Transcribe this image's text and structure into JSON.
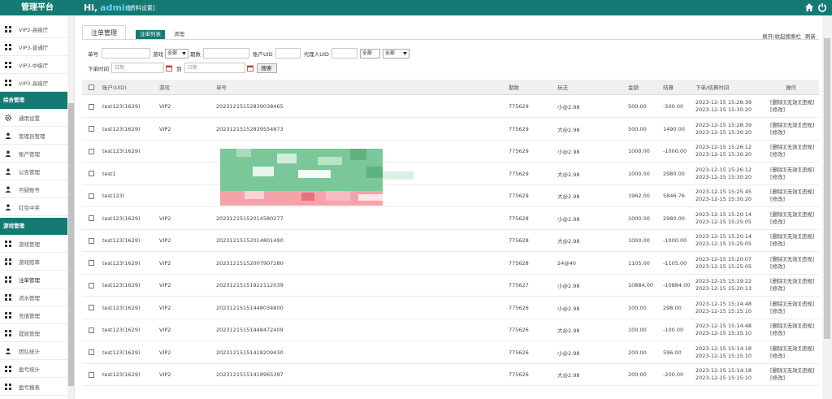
{
  "app": {
    "title": "管理平台",
    "greeting": "Hi,",
    "username": "admin",
    "profile_link": "[资料设置]",
    "colors": {
      "header": "#157a74",
      "username": "#5fd0ff",
      "mosaic_green": "#7cc79a",
      "mosaic_red": "#f5a3a9"
    },
    "icons": [
      "home-icon",
      "power-icon"
    ]
  },
  "sidebar": {
    "top_items": [
      {
        "label": "VIP2-高级厅"
      },
      {
        "label": "VIP3-普通厅"
      },
      {
        "label": "VIP3-中级厅"
      },
      {
        "label": "VIP3-高级厅"
      }
    ],
    "section1": "综合管理",
    "items1": [
      {
        "label": "通用设置"
      },
      {
        "label": "管理员管理"
      },
      {
        "label": "账户管理"
      },
      {
        "label": "公告管理"
      },
      {
        "label": "可疑账号"
      },
      {
        "label": "红包中奖"
      }
    ],
    "section2": "游戏管理",
    "items2": [
      {
        "label": "游戏管理"
      },
      {
        "label": "游戏赔率"
      },
      {
        "label": "注单管理"
      },
      {
        "label": "流水管理"
      },
      {
        "label": "充值管理"
      },
      {
        "label": "提现管理"
      },
      {
        "label": "团队统计"
      },
      {
        "label": "盈亏统计"
      },
      {
        "label": "盈亏报表"
      }
    ]
  },
  "tabs": {
    "page": "注单管理",
    "sub_active": "注单列表",
    "sub_other": "清理"
  },
  "top_links": {
    "toggle_search": "展开/收起搜索栏",
    "refresh": "刷新"
  },
  "filters": {
    "order_no_label": "单号",
    "game_label": "游戏",
    "game_value": "全部",
    "period_label": "期数",
    "account_uid_label": "账户UID",
    "agent_uid_label": "代理人UID",
    "agent_select_value": "全部",
    "extra_select_value": "全部",
    "order_time_label": "下单时间",
    "date_placeholder": "日期",
    "to_label": "到",
    "search_button": "搜索"
  },
  "table": {
    "headers": [
      "账户(UID)",
      "游戏",
      "单号",
      "期数",
      "玩法",
      "金额",
      "结算",
      "下单/结算时间",
      "操作"
    ],
    "ops": {
      "delete": "[删除]",
      "void": "[无效]",
      "foul": "[违规]",
      "edit": "[修改]"
    },
    "rows": [
      {
        "account": "test123(1629)",
        "game": "VIP2",
        "order": "20231215152839038465",
        "period": "775629",
        "play": "小@2.98",
        "amount": "500.00",
        "settle": "-500.00",
        "t1": "2023-12-15 15:28:39",
        "t2": "2023-12-15 15:30:20"
      },
      {
        "account": "test123(1629)",
        "game": "VIP2",
        "order": "20231215152839554873",
        "period": "775629",
        "play": "大@2.98",
        "amount": "500.00",
        "settle": "1490.00",
        "t1": "2023-12-15 15:28:39",
        "t2": "2023-12-15 15:30:20"
      },
      {
        "account": "test123(1629)",
        "game": "",
        "order": "",
        "period": "775629",
        "play": "小@2.98",
        "amount": "1000.00",
        "settle": "-1000.00",
        "t1": "2023-12-15 15:26:12",
        "t2": "2023-12-15 15:30:20"
      },
      {
        "account": "test1",
        "game": "",
        "order": "",
        "period": "775629",
        "play": "大@2.98",
        "amount": "1000.00",
        "settle": "2980.00",
        "t1": "2023-12-15 15:26:12",
        "t2": "2023-12-15 15:30:20"
      },
      {
        "account": "test123(",
        "game": "",
        "order": "",
        "period": "775629",
        "play": "大@2.98",
        "amount": "1962.00",
        "settle": "5846.76",
        "t1": "2023-12-15 15:25:45",
        "t2": "2023-12-15 15:30:20"
      },
      {
        "account": "test123(1629)",
        "game": "VIP2",
        "order": "20231215152014580277",
        "period": "775628",
        "play": "小@2.98",
        "amount": "1000.00",
        "settle": "2980.00",
        "t1": "2023-12-15 15:20:14",
        "t2": "2023-12-15 15:25:05"
      },
      {
        "account": "test123(1629)",
        "game": "VIP2",
        "order": "20231215152014801490",
        "period": "775628",
        "play": "大@2.98",
        "amount": "1000.00",
        "settle": "-1000.00",
        "t1": "2023-12-15 15:20:14",
        "t2": "2023-12-15 15:25:05"
      },
      {
        "account": "test123(1629)",
        "game": "VIP2",
        "order": "20231215152007907280",
        "period": "775628",
        "play": "24@40",
        "amount": "1105.00",
        "settle": "-1105.00",
        "t1": "2023-12-15 15:20:07",
        "t2": "2023-12-15 15:25:05"
      },
      {
        "account": "test123(1629)",
        "game": "VIP2",
        "order": "20231215151922112039",
        "period": "775627",
        "play": "小@2.98",
        "amount": "10884.00",
        "settle": "-10884.00",
        "t1": "2023-12-15 15:19:22",
        "t2": "2023-12-15 15:20:13"
      },
      {
        "account": "test123(1629)",
        "game": "VIP2",
        "order": "20231215151448034800",
        "period": "775626",
        "play": "小@2.98",
        "amount": "100.00",
        "settle": "298.00",
        "t1": "2023-12-15 15:14:48",
        "t2": "2023-12-15 15:15:10"
      },
      {
        "account": "test123(1629)",
        "game": "VIP2",
        "order": "20231215151448472409",
        "period": "775626",
        "play": "大@2.98",
        "amount": "100.00",
        "settle": "-100.00",
        "t1": "2023-12-15 15:14:48",
        "t2": "2023-12-15 15:15:10"
      },
      {
        "account": "test123(1629)",
        "game": "VIP2",
        "order": "20231215151418209430",
        "period": "775626",
        "play": "小@2.98",
        "amount": "200.00",
        "settle": "596.00",
        "t1": "2023-12-15 15:14:18",
        "t2": "2023-12-15 15:15:10"
      },
      {
        "account": "test123(1629)",
        "game": "VIP2",
        "order": "20231215151418965397",
        "period": "775626",
        "play": "大@2.98",
        "amount": "200.00",
        "settle": "-200.00",
        "t1": "2023-12-15 15:14:18",
        "t2": "2023-12-15 15:15:10"
      }
    ]
  }
}
